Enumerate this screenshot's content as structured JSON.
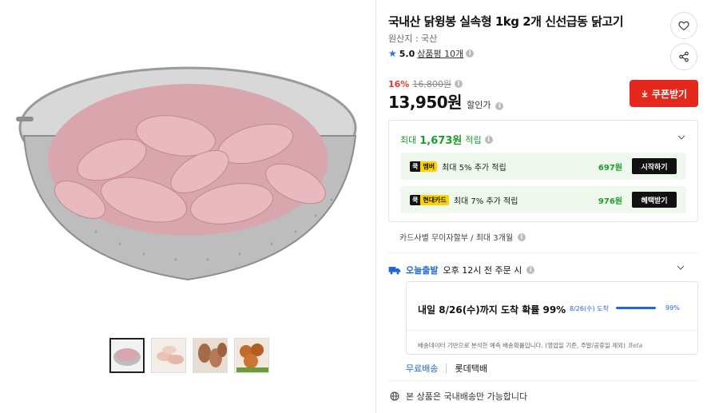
{
  "product": {
    "title": "국내산 닭윙봉 실속형 1kg 2개 신선급동 닭고기",
    "origin": "원산지 : 국산",
    "rating": "5.0",
    "review_link": "상품평 10개"
  },
  "price": {
    "discount_pct": "16%",
    "original": "16,800원",
    "sale": "13,950원",
    "sale_label": "할인가",
    "coupon_label": "쿠폰받기"
  },
  "reward": {
    "max_label": "최대",
    "max_amount": "1,673원",
    "max_suffix": "적립",
    "rows": [
      {
        "badge_rocket": "쿡",
        "badge": "멤버",
        "desc": "최대 5% 추가 적립",
        "amount": "697원",
        "button": "시작하기"
      },
      {
        "badge_rocket": "쿡",
        "badge": "현대카드",
        "desc": "최대 7% 추가 적립",
        "amount": "976원",
        "button": "혜택받기"
      }
    ]
  },
  "card_installment": "카드사별 무이자할부 / 최대 3개월",
  "delivery": {
    "today_label": "오늘출발",
    "today_desc": "오후 12시 전 주문 시",
    "arrival_main": "내일 8/26(수)까지 도착 확률 99%",
    "bar_label": "8/26(수) 도착",
    "bar_pct_value": 0.99,
    "bar_pct_text": "99%",
    "note": "배송데이터 기반으로 분석한 예측 배송확률입니다. (영업일 기준, 주말/공휴일 제외)",
    "beta": "Beta",
    "free_shipping": "무료배송",
    "carrier": "롯데택배"
  },
  "domestic_notice": "본 상품은 국내배송만 가능합니다",
  "icons": {
    "heart": "heart-icon",
    "share": "share-icon",
    "star": "star-icon",
    "info": "info-icon",
    "chevron": "chevron-down-icon",
    "download": "download-icon",
    "globe": "globe-icon",
    "truck": "truck-icon"
  },
  "colors": {
    "accent_red": "#e4281c",
    "reward_green": "#1a9e2b",
    "delivery_blue": "#1f67d6",
    "star_blue": "#2f6bff"
  }
}
